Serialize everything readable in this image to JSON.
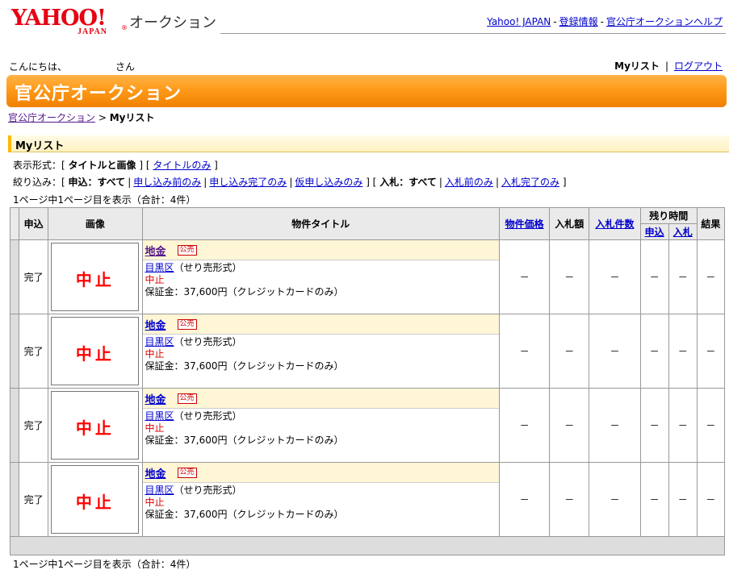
{
  "header": {
    "logo_text": "YAHOO!",
    "logo_sub": "JAPAN",
    "site_name": "オークション",
    "links": [
      "Yahoo! JAPAN",
      "登録情報",
      "官公庁オークションヘルプ"
    ]
  },
  "user": {
    "greeting": "こんにちは、",
    "san": "さん",
    "mylist": "Myリスト",
    "logout": "ログアウト"
  },
  "banner": {
    "title": "官公庁オークション"
  },
  "breadcrumb": {
    "home": "官公庁オークション",
    "sep": " > ",
    "current": "Myリスト"
  },
  "section": {
    "title": "Myリスト"
  },
  "display": {
    "label": "表示形式：[ ",
    "opt1": "タイトルと画像",
    "mid": " ] [ ",
    "opt2": "タイトルのみ",
    "end": " ]"
  },
  "filter": {
    "label": "絞り込み：[ ",
    "apply_all": "申込：すべて",
    "before": "申し込み前のみ",
    "done": "申し込み完了のみ",
    "tentative": "仮申し込みのみ",
    "mid": " ] [ ",
    "bid_all": "入札：すべて",
    "bid_before": "入札前のみ",
    "bid_done": "入札完了のみ",
    "end": " ]"
  },
  "page_info": "1ページ中1ページ目を表示（合計：4件）",
  "table": {
    "headers": {
      "apply": "申込",
      "image": "画像",
      "title": "物件タイトル",
      "price": "物件価格",
      "bid_amount": "入札額",
      "bid_count": "入札件数",
      "remaining": "残り時間",
      "rem_apply": "申込",
      "rem_bid": "入札",
      "result": "結果"
    },
    "rows": [
      {
        "status": "完了",
        "image_text": "中止",
        "title": "地金",
        "badge": "公売",
        "area": "目黒区",
        "format": "（せり売形式）",
        "state": "中止",
        "deposit": "保証金：37,600円（クレジットカードのみ）",
        "price": "－",
        "bid_amount": "－",
        "bid_count": "－",
        "rem_apply": "－",
        "rem_bid": "－",
        "result": "－"
      },
      {
        "status": "完了",
        "image_text": "中止",
        "title": "地金",
        "badge": "公売",
        "area": "目黒区",
        "format": "（せり売形式）",
        "state": "中止",
        "deposit": "保証金：37,600円（クレジットカードのみ）",
        "price": "－",
        "bid_amount": "－",
        "bid_count": "－",
        "rem_apply": "－",
        "rem_bid": "－",
        "result": "－"
      },
      {
        "status": "完了",
        "image_text": "中止",
        "title": "地金",
        "badge": "公売",
        "area": "目黒区",
        "format": "（せり売形式）",
        "state": "中止",
        "deposit": "保証金：37,600円（クレジットカードのみ）",
        "price": "－",
        "bid_amount": "－",
        "bid_count": "－",
        "rem_apply": "－",
        "rem_bid": "－",
        "result": "－"
      },
      {
        "status": "完了",
        "image_text": "中止",
        "title": "地金",
        "badge": "公売",
        "area": "目黒区",
        "format": "（せり売形式）",
        "state": "中止",
        "deposit": "保証金：37,600円（クレジットカードのみ）",
        "price": "－",
        "bid_amount": "－",
        "bid_count": "－",
        "rem_apply": "－",
        "rem_bid": "－",
        "result": "－"
      }
    ]
  },
  "colors": {
    "banner": "#ff9a1a",
    "logo": "#e60012",
    "link": "#0000cc",
    "stop": "#ff0000"
  }
}
